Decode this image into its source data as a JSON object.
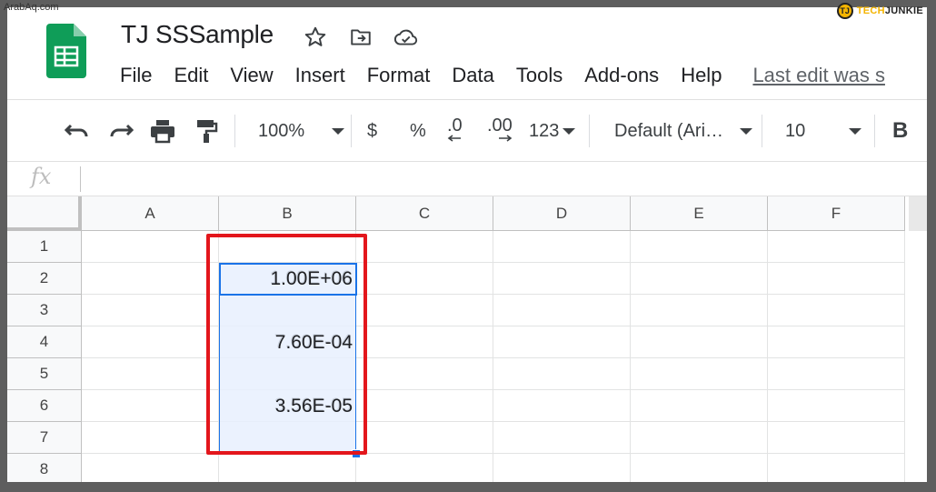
{
  "watermark": "ArabAq.com",
  "brand": {
    "badge": "TJ",
    "name_a": "TECH",
    "name_b": "JUNKIE"
  },
  "doc": {
    "title": "TJ SSSample"
  },
  "menu": [
    "File",
    "Edit",
    "View",
    "Insert",
    "Format",
    "Data",
    "Tools",
    "Add-ons",
    "Help"
  ],
  "last_edit": "Last edit was s",
  "toolbar": {
    "zoom": "100%",
    "currency": "$",
    "percent": "%",
    "dec_decrease": ".0",
    "dec_increase": ".00",
    "more_formats": "123",
    "font": "Default (Ari…",
    "font_size": "10",
    "bold": "B"
  },
  "formula_bar": {
    "fx": "fx",
    "value": ""
  },
  "columns": [
    "A",
    "B",
    "C",
    "D",
    "E",
    "F"
  ],
  "rows": [
    "1",
    "2",
    "3",
    "4",
    "5",
    "6",
    "7",
    "8"
  ],
  "cells": {
    "B2": "1.00E+06",
    "B4": "7.60E-04",
    "B6": "3.56E-05"
  },
  "colors": {
    "selection_border": "#1a73e8",
    "selection_fill": "#e8f0fe",
    "highlight_box": "#e3161c",
    "sheets_green": "#0f9d58"
  }
}
